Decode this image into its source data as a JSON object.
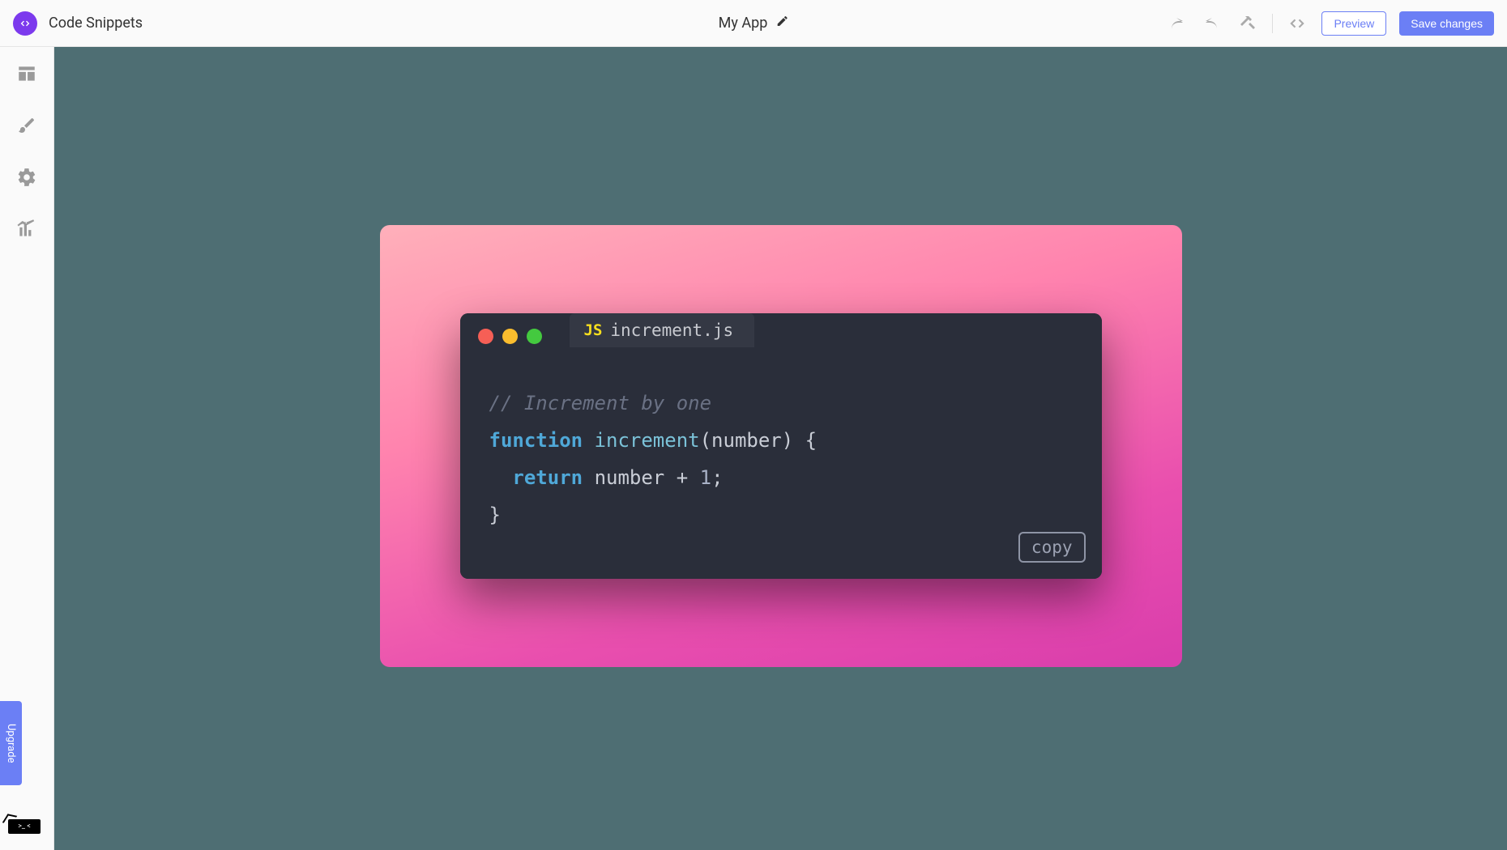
{
  "header": {
    "title": "Code Snippets",
    "app_name": "My App",
    "preview_label": "Preview",
    "save_label": "Save changes"
  },
  "sidebar": {
    "upgrade_label": "Upgrade",
    "terminal_label": ">_ <"
  },
  "snippet": {
    "filename": "increment.js",
    "lang_badge": "JS",
    "copy_label": "copy",
    "code": {
      "comment": "// Increment by one",
      "kw_function": "function",
      "func_name": "increment",
      "param": "number",
      "kw_return": "return",
      "ret_expr_ident": "number",
      "ret_expr_op": "+",
      "ret_expr_num": "1",
      "open_paren": "(",
      "close_paren": ")",
      "open_brace": "{",
      "close_brace": "}",
      "semicolon": ";"
    }
  },
  "colors": {
    "canvas_bg": "#4E6E73",
    "accent": "#6B7FF5"
  }
}
